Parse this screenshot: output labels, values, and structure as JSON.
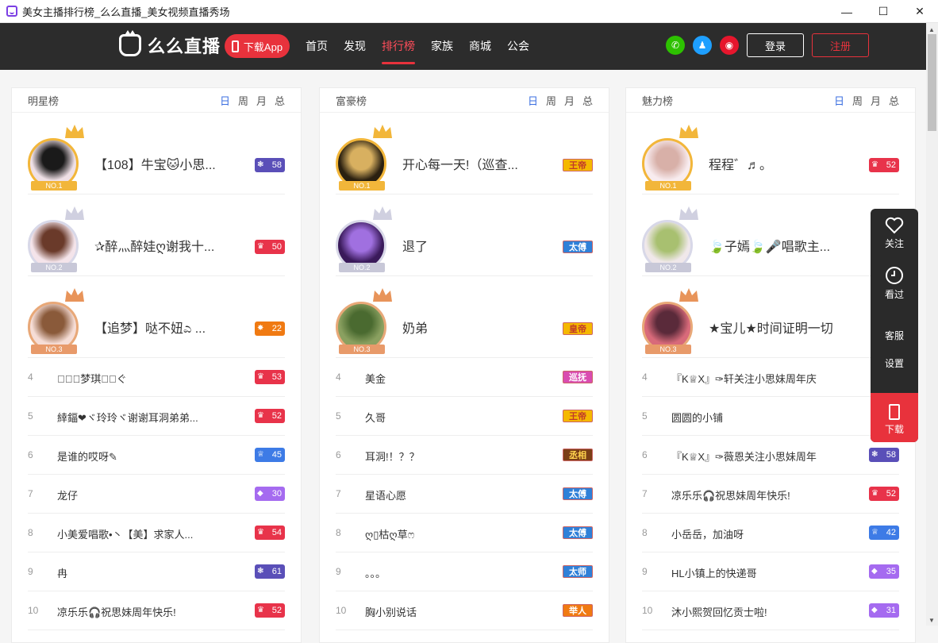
{
  "window": {
    "title": "美女主播排行榜_么么直播_美女视频直播秀场",
    "minimize": "—",
    "maximize": "☐",
    "close": "✕"
  },
  "nav": {
    "logo_text": "么么直播",
    "download_app": "下载App",
    "links": [
      "首页",
      "发现",
      "排行榜",
      "家族",
      "商城",
      "公会"
    ],
    "active_index": 2,
    "social": [
      {
        "icon": "wechat-icon",
        "color": "#2dc100"
      },
      {
        "icon": "qq-icon",
        "color": "#1e9fff"
      },
      {
        "icon": "weibo-icon",
        "color": "#e6162d"
      }
    ],
    "login": "登录",
    "register": "注册"
  },
  "periods": [
    "日",
    "周",
    "月",
    "总"
  ],
  "panels": [
    {
      "title": "明星榜",
      "top3": [
        {
          "rank": "NO.1",
          "name": "【108】牛宝🐱小思...",
          "badge_type": "level",
          "badge_color": "#5a4fb8",
          "badge_icon": "❃",
          "value": "58"
        },
        {
          "rank": "NO.2",
          "name": "✰醉灬醉娃ღ谢我十...",
          "badge_type": "level",
          "badge_color": "#e8334a",
          "badge_icon": "♛",
          "value": "50"
        },
        {
          "rank": "NO.3",
          "name": "【追梦】哒不妞ಎ ...",
          "badge_type": "level",
          "badge_color": "#f07a12",
          "badge_icon": "✸",
          "value": "22"
        }
      ],
      "rows": [
        {
          "rank": "4",
          "name": "ぐ⃢⃝梦琪ิ⃢ぐ",
          "badge_type": "level",
          "badge_color": "#e8334a",
          "badge_icon": "♛",
          "value": "53"
        },
        {
          "rank": "5",
          "name": "緈鍢❤ヾ玲玲ヾ谢谢耳洞弟弟...",
          "badge_type": "level",
          "badge_color": "#e8334a",
          "badge_icon": "♛",
          "value": "52"
        },
        {
          "rank": "6",
          "name": "是谁的哎呀✎",
          "badge_type": "level",
          "badge_color": "#3d7be6",
          "badge_icon": "♕",
          "value": "45"
        },
        {
          "rank": "7",
          "name": "龙仔",
          "badge_type": "level",
          "badge_color": "#a56bf0",
          "badge_icon": "◆",
          "value": "30"
        },
        {
          "rank": "8",
          "name": "小美爱唱歌•丶【美】求家人...",
          "badge_type": "level",
          "badge_color": "#e8334a",
          "badge_icon": "♛",
          "value": "54"
        },
        {
          "rank": "9",
          "name": "冉",
          "badge_type": "level",
          "badge_color": "#5a4fb8",
          "badge_icon": "❃",
          "value": "61"
        },
        {
          "rank": "10",
          "name": "凉乐乐🎧祝思妹周年快乐!",
          "badge_type": "level",
          "badge_color": "#e8334a",
          "badge_icon": "♛",
          "value": "52"
        }
      ]
    },
    {
      "title": "富豪榜",
      "top3": [
        {
          "rank": "NO.1",
          "name": "开心每一天!（巡查...",
          "badge_type": "title",
          "badge_color": "#f5b800",
          "badge_text_color": "#c0392b",
          "value": "王帝"
        },
        {
          "rank": "NO.2",
          "name": "退了",
          "badge_type": "title",
          "badge_color": "#2f80d8",
          "badge_text_color": "#fff",
          "value": "太傅"
        },
        {
          "rank": "NO.3",
          "name": "奶弟",
          "badge_type": "title",
          "badge_color": "#f5b800",
          "badge_text_color": "#c0392b",
          "value": "皇帝"
        }
      ],
      "rows": [
        {
          "rank": "4",
          "name": "美金",
          "badge_type": "title",
          "badge_color": "#d94cb0",
          "badge_text_color": "#fff",
          "value": "巡抚"
        },
        {
          "rank": "5",
          "name": "久哥",
          "badge_type": "title",
          "badge_color": "#f5b800",
          "badge_text_color": "#c0392b",
          "value": "王帝"
        },
        {
          "rank": "6",
          "name": "耳洞!！？？",
          "badge_type": "title",
          "badge_color": "#7b3f16",
          "badge_text_color": "#ffd34d",
          "value": "丞相"
        },
        {
          "rank": "7",
          "name": "星语心愿",
          "badge_type": "title",
          "badge_color": "#2f80d8",
          "badge_text_color": "#fff",
          "value": "太傅"
        },
        {
          "rank": "8",
          "name": "ღ▯枯ღ草ෆ",
          "badge_type": "title",
          "badge_color": "#2f80d8",
          "badge_text_color": "#fff",
          "value": "太傅"
        },
        {
          "rank": "9",
          "name": "。。。",
          "badge_type": "title",
          "badge_color": "#2f80d8",
          "badge_text_color": "#fff",
          "value": "太师"
        },
        {
          "rank": "10",
          "name": "胸小别说话",
          "badge_type": "title",
          "badge_color": "#f07a12",
          "badge_text_color": "#fff",
          "value": "举人"
        }
      ]
    },
    {
      "title": "魅力榜",
      "top3": [
        {
          "rank": "NO.1",
          "name": "程程゛♬。",
          "badge_type": "level",
          "badge_color": "#e8334a",
          "badge_icon": "♛",
          "value": "52"
        },
        {
          "rank": "NO.2",
          "name": "🍃子嫣🍃🎤唱歌主...",
          "badge_type": "none",
          "value": ""
        },
        {
          "rank": "NO.3",
          "name": "★宝儿★时间证明一切",
          "badge_type": "none",
          "value": ""
        }
      ],
      "rows": [
        {
          "rank": "4",
          "name": "『K♕X』✑轩关注小思妹周年庆",
          "badge_type": "none",
          "value": ""
        },
        {
          "rank": "5",
          "name": "圆圆的小铺",
          "badge_type": "none",
          "value": ""
        },
        {
          "rank": "6",
          "name": "『K♕X』✑薇恩关注小思妹周年",
          "badge_type": "level",
          "badge_color": "#5a4fb8",
          "badge_icon": "❃",
          "value": "58"
        },
        {
          "rank": "7",
          "name": "凉乐乐🎧祝思妹周年快乐!",
          "badge_type": "level",
          "badge_color": "#e8334a",
          "badge_icon": "♛",
          "value": "52"
        },
        {
          "rank": "8",
          "name": "小岳岳，加油呀",
          "badge_type": "level",
          "badge_color": "#3d7be6",
          "badge_icon": "♕",
          "value": "42"
        },
        {
          "rank": "9",
          "name": "HL小镇上的快递哥",
          "badge_type": "level",
          "badge_color": "#a56bf0",
          "badge_icon": "◆",
          "value": "35"
        },
        {
          "rank": "10",
          "name": "沐小熙贺回忆贡士啦!",
          "badge_type": "level",
          "badge_color": "#a56bf0",
          "badge_icon": "◆",
          "value": "31"
        }
      ]
    }
  ],
  "sidetool": {
    "follow": "关注",
    "watched": "看过",
    "service": "客服",
    "settings": "设置",
    "download": "下载"
  }
}
